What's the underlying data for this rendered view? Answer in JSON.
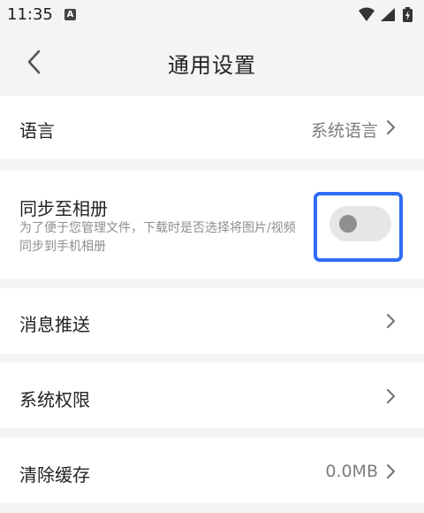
{
  "status_bar": {
    "time": "11:35",
    "notification_badge": "A",
    "icons": [
      "wifi-icon",
      "cell-signal-icon",
      "battery-charging-icon"
    ]
  },
  "header": {
    "title": "通用设置",
    "back_icon": "chevron-left-icon"
  },
  "settings": {
    "language": {
      "label": "语言",
      "value": "系统语言"
    },
    "sync_album": {
      "label": "同步至相册",
      "description": "为了便于您管理文件，下载时是否选择将图片/视频同步到手机相册",
      "enabled": false
    },
    "push": {
      "label": "消息推送"
    },
    "permissions": {
      "label": "系统权限"
    },
    "cache": {
      "label": "清除缓存",
      "value": "0.0MB"
    }
  },
  "colors": {
    "background": "#f3f4f6",
    "row_background": "#ffffff",
    "highlight": "#2f6cf6",
    "toggle_off_track": "#e6e6e6",
    "toggle_off_knob": "#8f8f8f",
    "secondary_text": "#7d7d7d"
  }
}
